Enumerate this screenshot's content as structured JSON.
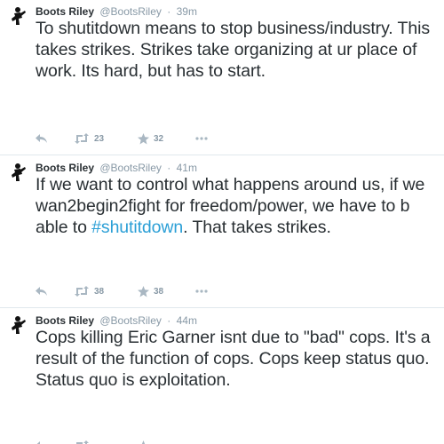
{
  "tweets": [
    {
      "name": "Boots Riley",
      "handle": "@BootsRiley",
      "time": "39m",
      "text_before": "To shutitdown means to stop business/industry. This takes strikes. Strikes take organizing at ur place of work. Its hard, but has to start.",
      "hashtag": "",
      "text_after": "",
      "retweets": "23",
      "favorites": "32"
    },
    {
      "name": "Boots Riley",
      "handle": "@BootsRiley",
      "time": "41m",
      "text_before": "If we want to control what happens around us, if we wan2begin2fight for freedom/power, we have to b able to ",
      "hashtag": "#shutitdown",
      "text_after": ". That takes strikes.",
      "retweets": "38",
      "favorites": "38"
    },
    {
      "name": "Boots Riley",
      "handle": "@BootsRiley",
      "time": "44m",
      "text_before": "Cops killing Eric Garner isnt due to \"bad\" cops. It's a result of the function of cops. Cops keep status quo. Status quo is exploitation.",
      "hashtag": "",
      "text_after": "",
      "retweets": "",
      "favorites": ""
    }
  ],
  "colors": {
    "name": "#292f33",
    "meta": "#8899a6",
    "hashtag": "#2b9fd6",
    "icon": "#a9b7c2"
  },
  "icons": [
    "avatar",
    "reply-icon",
    "retweet-icon",
    "favorite-star-icon",
    "more-icon"
  ]
}
